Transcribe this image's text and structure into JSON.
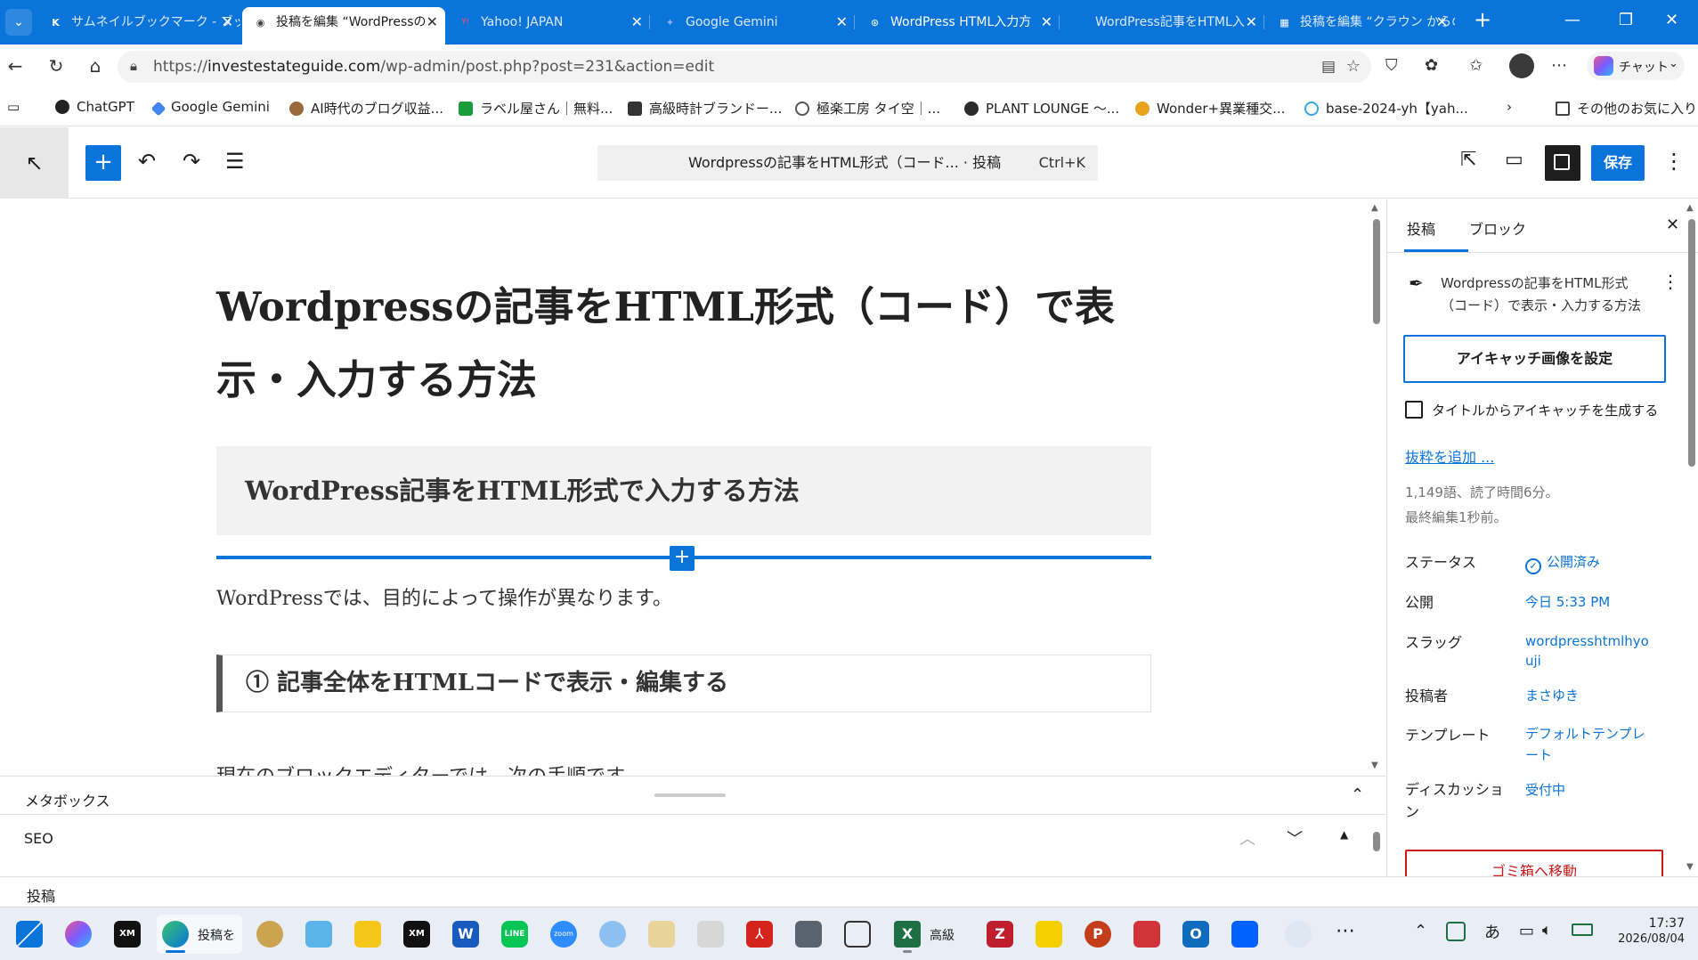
{
  "browser": {
    "tabs": [
      {
        "label": "サムネイルブックマーク - ブッ",
        "favicon": "K",
        "favicon_color": "#ffffff"
      },
      {
        "label": "投稿を編集 “WordPressの",
        "favicon": "◉",
        "favicon_color": "#444444",
        "active": true
      },
      {
        "label": "Yahoo! JAPAN",
        "favicon": "Y!",
        "favicon_color": "#ff0033"
      },
      {
        "label": "Google Gemini",
        "favicon": "✦",
        "favicon_color": "#4285f4"
      },
      {
        "label": "WordPress HTML入力方",
        "favicon": "⊛",
        "favicon_color": "#ffffff"
      },
      {
        "label": "WordPress記事をHTML入",
        "favicon": "",
        "favicon_color": "#ffffff"
      },
      {
        "label": "投稿を編集 “クラウン からの",
        "favicon": "▦",
        "favicon_color": "#ffffff"
      }
    ],
    "url_prefix": "https://",
    "url_host": "investestateguide.com",
    "url_path": "/wp-admin/post.php?post=231&action=edit",
    "copilot_label": "チャット",
    "bookmarks": [
      {
        "label": "ChatGPT",
        "color": "#222222"
      },
      {
        "label": "Google Gemini",
        "color": "#4285f4"
      },
      {
        "label": "AI時代のブログ収益...",
        "color": "#9b6a3c"
      },
      {
        "label": "ラベル屋さん｜無料...",
        "color": "#1a9b3c"
      },
      {
        "label": "高級時計ブランドー...",
        "color": "#333333"
      },
      {
        "label": "極楽工房 タイ空｜...",
        "color": "#555555"
      },
      {
        "label": "PLANT LOUNGE 〜...",
        "color": "#2b2b2b"
      },
      {
        "label": "Wonder+異業種交...",
        "color": "#e8a31c"
      },
      {
        "label": "base-2024-yh【yah...",
        "color": "#35a7e0"
      }
    ],
    "bookmarks_more": "その他のお気に入り"
  },
  "editor": {
    "command_bar_text": "Wordpressの記事をHTML形式（コード... · 投稿",
    "command_bar_shortcut": "Ctrl+K",
    "save_label": "保存",
    "post_title": "Wordpressの記事をHTML形式（コード）で表示・入力する方法",
    "h2": "WordPress記事をHTML形式で入力する方法",
    "para1": "WordPressでは、目的によって操作が異なります。",
    "h3": "① 記事全体をHTMLコードで表示・編集する",
    "para2": "現在のブロックエディターでは、次の手順です。"
  },
  "metabox": {
    "title": "メタボックス",
    "seo": "SEO",
    "footer": "投稿"
  },
  "sidebar": {
    "tab_post": "投稿",
    "tab_block": "ブロック",
    "post_title": "Wordpressの記事をHTML形式（コード）で表示・入力する方法",
    "featured_button": "アイキャッチ画像を設定",
    "checkbox_label": "タイトルからアイキャッチを生成する",
    "excerpt_link": "抜粋を追加 ...",
    "stats_words": "1,149語、読了時間6分。",
    "stats_edited": "最終編集1秒前。",
    "rows": [
      {
        "label": "ステータス",
        "value": "公開済み"
      },
      {
        "label": "公開",
        "value": "今日 5:33 PM"
      },
      {
        "label": "スラッグ",
        "value": "wordpresshtmlhyouji"
      },
      {
        "label": "投稿者",
        "value": "まさゆき"
      },
      {
        "label": "テンプレート",
        "value": "デフォルトテンプレート"
      },
      {
        "label": "ディスカッション",
        "value": "受付中"
      }
    ],
    "trash_button": "ゴミ箱へ移動"
  },
  "taskbar": {
    "edge_label": "投稿を",
    "excel_label": "高級",
    "time": "17:37",
    "date": "2026/08/04",
    "ime": "あ"
  },
  "colors": {
    "accent": "#0a74da",
    "browser_bar": "#0a74da",
    "danger": "#cc1818"
  }
}
